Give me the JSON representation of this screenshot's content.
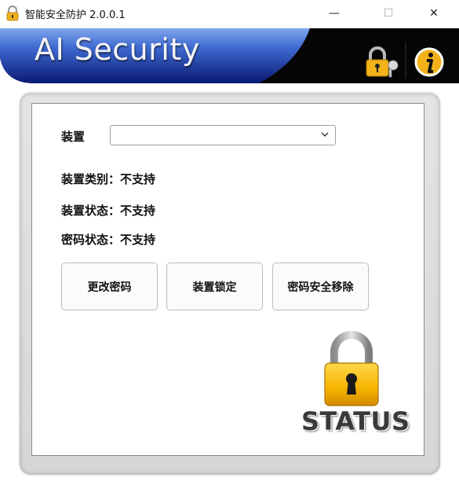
{
  "window": {
    "title": "智能安全防护 2.0.0.1",
    "minimize_glyph": "—",
    "maximize_glyph": "☐",
    "close_glyph": "✕"
  },
  "banner": {
    "title": "AI Security",
    "key_icon": "lock-key-icon",
    "info_icon": "info-icon",
    "colors": {
      "blue_light": "#4f7fd6",
      "blue_dark": "#0c1a6e",
      "black": "#000000"
    }
  },
  "device": {
    "label": "装置",
    "selected_value": ""
  },
  "info": {
    "type_label": "装置类别：",
    "type_value": "不支持",
    "state_label": "装置状态：",
    "state_value": "不支持",
    "password_label": "密码状态：",
    "password_value": "不支持"
  },
  "actions": {
    "change_password": "更改密码",
    "lock_device": "装置锁定",
    "secure_remove": "密码安全移除"
  },
  "status": {
    "text": "STATUS",
    "icon": "padlock-icon",
    "lock_color": "#f5b400"
  }
}
